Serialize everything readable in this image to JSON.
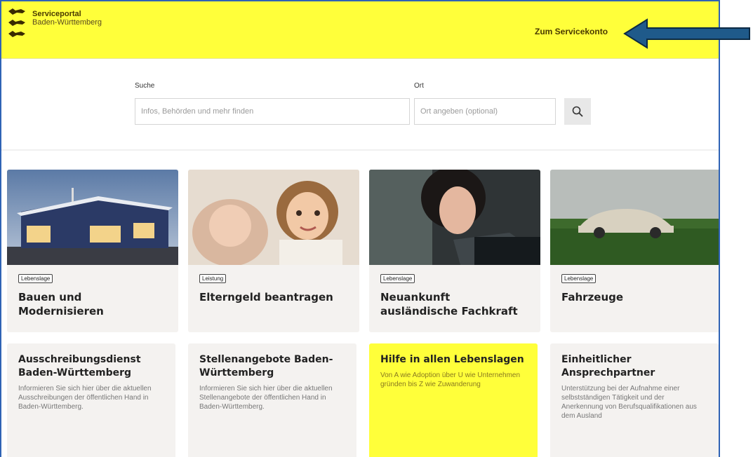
{
  "header": {
    "brand_line1": "Serviceportal",
    "brand_line2": "Baden-Württemberg",
    "servicekonto_link": "Zum Servicekonto",
    "background_color": "#ffff3a"
  },
  "search": {
    "query_label": "Suche",
    "query_placeholder": "Infos, Behörden und mehr finden",
    "location_label": "Ort",
    "location_placeholder": "Ort angeben (optional)",
    "button_icon": "search-icon"
  },
  "cards": [
    {
      "tag": "Lebenslage",
      "title": "Bauen und Modernisieren",
      "image": "house-at-dusk"
    },
    {
      "tag": "Leistung",
      "title": "Elterngeld beantragen",
      "image": "baby-and-child"
    },
    {
      "tag": "Lebenslage",
      "title": "Neuankunft ausländische Fachkraft",
      "image": "woman-at-laptop"
    },
    {
      "tag": "Lebenslage",
      "title": "Fahrzeuge",
      "image": "vintage-car-in-field"
    }
  ],
  "info_tiles": [
    {
      "title": "Ausschreibungsdienst Baden-Württemberg",
      "text": "Informieren Sie sich hier über die aktuellen Ausschreibungen der öffentlichen Hand in Baden-Württemberg."
    },
    {
      "title": "Stellenangebote Baden-Württemberg",
      "text": "Informieren Sie sich hier über die aktuellen Stellenangebote der öffentlichen Hand in Baden-Württemberg."
    },
    {
      "title": "Hilfe in allen Lebenslagen",
      "text": "Von A wie Adoption über U wie Unternehmen gründen bis Z wie Zuwanderung"
    },
    {
      "title": "Einheitlicher Ansprechpartner",
      "text": "Unterstützung bei der Aufnahme einer selbstständigen Tätigkeit und der Anerkennung von Berufsqualifikationen aus dem Ausland"
    }
  ],
  "annotation": {
    "arrow_color": "#1f5a8a",
    "arrow_icon": "left-arrow-annotation"
  }
}
